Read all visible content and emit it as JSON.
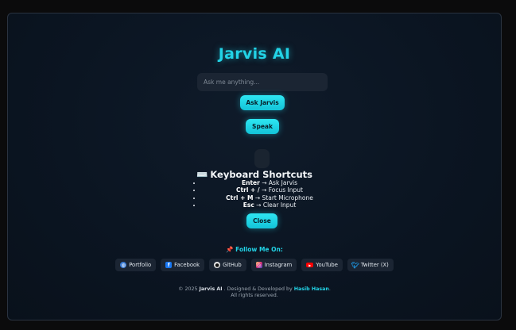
{
  "app": {
    "title": "Jarvis AI"
  },
  "search": {
    "placeholder": "Ask me anything...",
    "value": ""
  },
  "buttons": {
    "ask": "Ask Jarvis",
    "speak": "Speak",
    "close": "Close"
  },
  "shortcuts": {
    "icon": "⌨️",
    "title": "Keyboard Shortcuts",
    "items": [
      {
        "key": "Enter",
        "arrow": " → ",
        "desc": "Ask Jarvis"
      },
      {
        "key": "Ctrl + /",
        "arrow": " → ",
        "desc": "Focus Input"
      },
      {
        "key": "Ctrl + M",
        "arrow": " → ",
        "desc": "Start Microphone"
      },
      {
        "key": "Esc",
        "arrow": " → ",
        "desc": "Clear Input"
      }
    ]
  },
  "follow": {
    "icon": "📌",
    "label": "Follow Me On:"
  },
  "socials": [
    {
      "label": "Portfolio",
      "icon": "globe-icon",
      "color": "#3a7bd5"
    },
    {
      "label": "Facebook",
      "icon": "facebook-icon",
      "color": "#1877f2"
    },
    {
      "label": "GitHub",
      "icon": "github-icon",
      "color": "#e6e6e6"
    },
    {
      "label": "Instagram",
      "icon": "instagram-icon",
      "color": "#d62976"
    },
    {
      "label": "YouTube",
      "icon": "youtube-icon",
      "color": "#ff0000"
    },
    {
      "label": "Twitter (X)",
      "icon": "twitter-icon",
      "color": "#1da1f2"
    }
  ],
  "footer": {
    "copy": "© 2025 ",
    "brand": "Jarvis AI",
    "designed": " . Designed & Developed by ",
    "author": "Hasib Hasan",
    "period": ".",
    "rights": "All rights reserved."
  },
  "colors": {
    "accent": "#22d3e6",
    "panel": "#0b1522",
    "chip": "#1b2533"
  }
}
